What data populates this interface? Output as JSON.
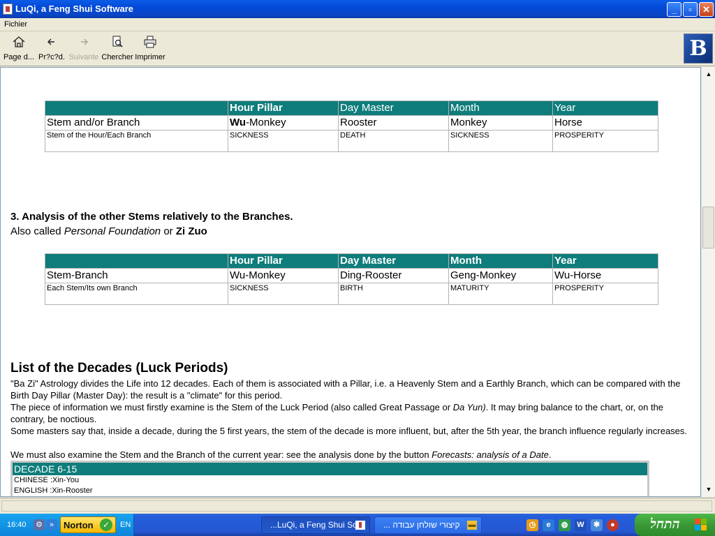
{
  "window": {
    "title": "LuQi, a Feng Shui Software",
    "minimize": "_",
    "maximize": "▫",
    "close": "✕"
  },
  "menu": {
    "file": "Fichier"
  },
  "toolbar": {
    "home": "Page d...",
    "back": "Pr?c?d.",
    "forward": "Suivante",
    "search": "Chercher",
    "print": "Imprimer",
    "logo": "B"
  },
  "table1": {
    "headers": [
      "Hour Pillar",
      "Day Master",
      "Month",
      "Year"
    ],
    "row1_label": "Stem and/or Branch",
    "row1_prefix": "Wu",
    "row1_suffix": "-Monkey",
    "row1": [
      "Rooster",
      "Monkey",
      "Horse"
    ],
    "row2_label": "Stem of the Hour/Each Branch",
    "row2": [
      "SICKNESS",
      "DEATH",
      "SICKNESS",
      "PROSPERITY"
    ]
  },
  "section3": {
    "heading": "3. Analysis of the other Stems relatively to the Branches.",
    "sub_prefix": "Also called ",
    "sub_italic": "Personal Foundation",
    "sub_or": " or ",
    "sub_bold": "Zi Zuo"
  },
  "table2": {
    "headers": [
      "Hour Pillar",
      "Day Master",
      "Month",
      "Year"
    ],
    "row1_label": "Stem-Branch",
    "row1": [
      "Wu-Monkey",
      "Ding-Rooster",
      "Geng-Monkey",
      "Wu-Horse"
    ],
    "row2_label": "Each Stem/Its own Branch",
    "row2": [
      "SICKNESS",
      "BIRTH",
      "MATURITY",
      "PROSPERITY"
    ]
  },
  "decades": {
    "heading": "List of the Decades (Luck Periods)",
    "p1": "\"Ba Zi\" Astrology divides the Life into 12 decades. Each of them is associated with a Pillar, i.e. a Heavenly Stem and a Earthly Branch, which can be compared with the Birth Day Pillar (Master Day): the result is a \"climate\" for this period.",
    "p2a": "The piece of information we must firstly examine is the Stem of the Luck Period (also called Great Passage or ",
    "p2i": "Da Yun)",
    "p2b": ". It may bring balance to the chart, or, on the contrary, be noctious.",
    "p3": "Some masters say that, inside a decade, during the 5 first years, the stem of the decade is more influent, but, after the 5th year, the branch influence regularly increases.",
    "p4a": "We must also examine the Stem and the Branch of the current year: see the analysis done by the button ",
    "p4i": "Forecasts: analysis of a Date",
    "p4b": ".",
    "box_title": "DECADE 6-15",
    "box_line1": "CHINESE :Xin-You",
    "box_line2": "ENGLISH :Xin-Rooster"
  },
  "taskbar": {
    "time": "16:40",
    "norton": "Norton",
    "norton_check": "✓",
    "lang": "EN",
    "task1": "...LuQi, a Feng Shui Sof",
    "task2": "... קיצורי שולחן עבודה",
    "start": "התחל",
    "colors": {
      "accent": "#0E7D7B",
      "taskbar": "#245EDC",
      "start": "#3A9A36"
    }
  },
  "icons": [
    "app-icon",
    "home-icon",
    "back-arrow-icon",
    "forward-arrow-icon",
    "search-icon",
    "printer-icon",
    "scroll-up-icon",
    "scroll-down-icon",
    "norton-check-icon",
    "windows-flag-icon",
    "folder-icon",
    "clock-icon",
    "ie-icon",
    "word-icon"
  ]
}
